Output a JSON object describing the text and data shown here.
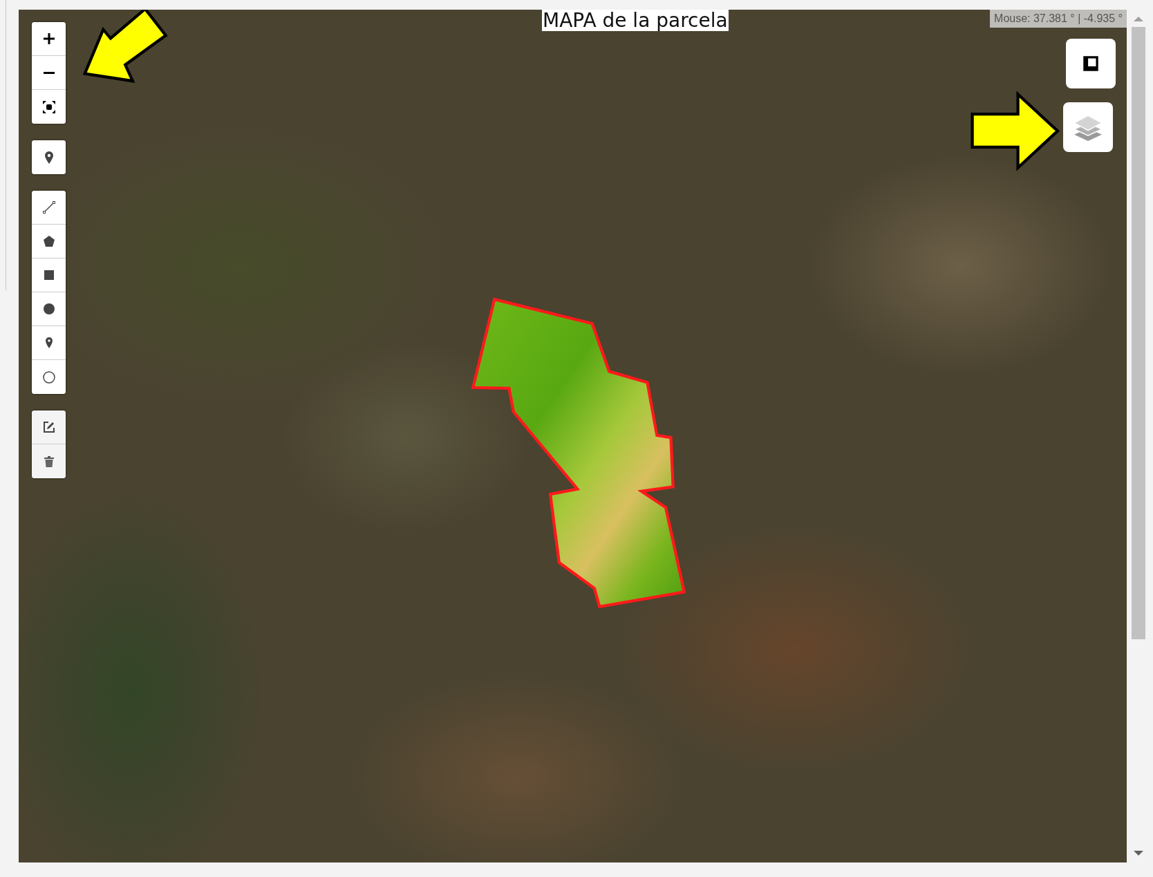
{
  "map": {
    "title": "MAPA de la parcela",
    "mouse_readout": "Mouse: 37.381 ° | -4.935 °"
  }
}
